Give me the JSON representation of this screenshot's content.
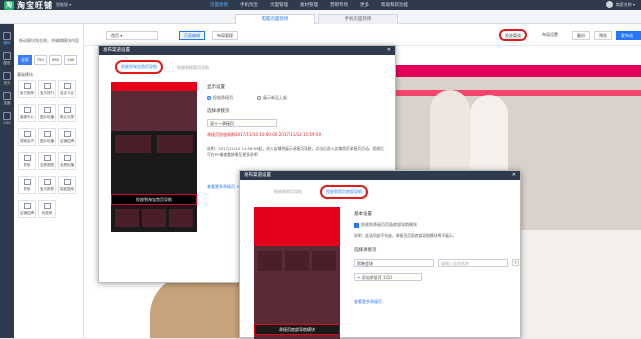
{
  "app": {
    "logo_mark": "淘",
    "logo_text": "淘宝旺铺",
    "version": "智能版 ▾"
  },
  "top_nav": [
    "页面装修",
    "手机淘宝",
    "页面管理",
    "素材管理",
    "营销专场",
    "更多",
    "帮助和新功能"
  ],
  "user": {
    "name": "商家名称 ▾"
  },
  "sub_tabs": [
    "电脑页面装修",
    "手机页面装修"
  ],
  "left_rail": [
    "模块",
    "配色",
    "页头",
    "页面",
    "CSS"
  ],
  "left_panel": {
    "tip": "拖动模块到右侧，并编辑模块内容",
    "sizes": [
      "全部",
      "750",
      "990",
      "190"
    ],
    "group": "基础模块",
    "tiles": [
      "宝贝推荐",
      "宝贝排行",
      "自定义区",
      "客服中心",
      "图片轮播",
      "默认分类",
      "搜索店内",
      "图片轮播",
      "店铺招牌",
      "导航",
      "全屏宽图",
      "全屏轮播",
      "导航",
      "宝贝推荐",
      "智能搜索",
      "店铺招牌",
      "优惠券"
    ]
  },
  "toolbar": {
    "page_select": "首页 ▾",
    "btn_edit": "页面编辑",
    "btn_layout": "布局管理",
    "btn_publish_set": "投放渠道",
    "btn_backup": "布局设置",
    "btn_save": "备份",
    "btn_preview": "预览",
    "btn_publish": "发布站点"
  },
  "dialog1": {
    "title": "发布渠道设置",
    "tab_active": "投放到淘宝首页导航",
    "tab_other": "投放到搜索页导航",
    "phone_nav": "投放到淘宝首页导航",
    "sec_display": "显示设置",
    "radio_on": "投放承接页",
    "radio_off": "展示新品上架",
    "sec_select": "选择承接页",
    "select_val": "双十一承接页",
    "err": "承接页投放周期2017/11/10 10:00:00-2017/11/12 11:59:59",
    "desc": "说明：2017/11/10 11:59:59起，进入店铺将展示承接页导航，点击后进入店铺首页承接页活动。投放后可在PC端查看效果及更多说明",
    "link": "查看更多承接页 >"
  },
  "dialog2": {
    "title": "发布渠道设置",
    "tab_other": "投放到首页导航",
    "tab_active": "投放到首页底部导航",
    "sec_basic": "基本设置",
    "checkbox": "投放到承接页页面底部导航模块",
    "check_desc": "说明：此选项若不勾选，承接页页面底部导航模块将不展示。",
    "sec_select": "选择承接页",
    "select1": "男装会场",
    "select2": "请输入会场名称",
    "add_btn": "+ 添加承接页 1/10",
    "link": "查看更多承接页",
    "phone_label": "承接页底部导航模块"
  }
}
